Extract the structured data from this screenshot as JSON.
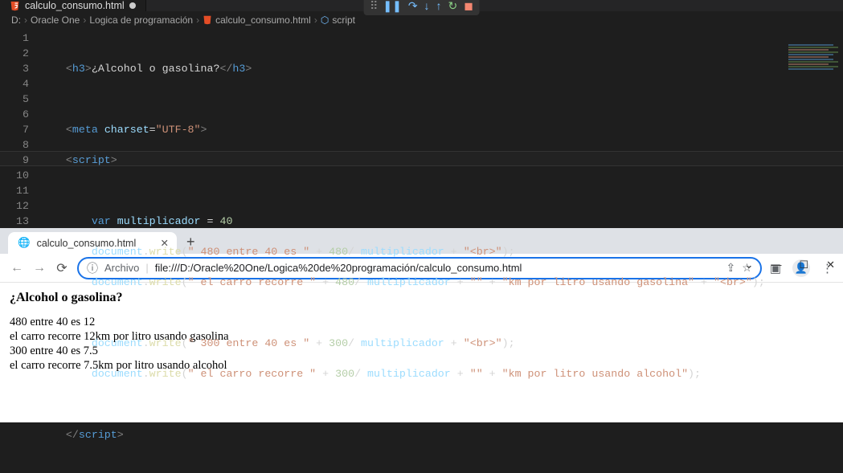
{
  "editor": {
    "tab_filename": "calculo_consumo.html",
    "breadcrumbs": {
      "drive": "D:",
      "p1": "Oracle One",
      "p2": "Logica de programación",
      "file": "calculo_consumo.html",
      "symbol": "script"
    },
    "line_numbers": [
      "1",
      "2",
      "3",
      "4",
      "5",
      "6",
      "7",
      "8",
      "9",
      "10",
      "11",
      "12",
      "13"
    ],
    "code": {
      "l1": {
        "pre": "    ",
        "open": "<",
        "tag": "h3",
        "close": ">",
        "text": "¿Alcohol o gasolina?",
        "open2": "</",
        "tag2": "h3",
        "close2": ">"
      },
      "l3": {
        "pre": "    ",
        "open": "<",
        "tag": "meta",
        "sp": " ",
        "attr": "charset",
        "eq": "=",
        "val": "\"UTF-8\"",
        "close": ">"
      },
      "l4": {
        "pre": "    ",
        "open": "<",
        "tag": "script",
        "close": ">"
      },
      "l6": {
        "pre": "        ",
        "kw": "var",
        "sp": " ",
        "id": "multiplicador",
        "rest": " = ",
        "num": "40"
      },
      "l7": {
        "pre": "        ",
        "obj": "document",
        "dot": ".",
        "fn": "write",
        "open": "(",
        "s1": "\" 480 entre 40 es \"",
        "p1": " + ",
        "n1": "480",
        "p2": "/ ",
        "id": "multiplicador",
        "p3": " + ",
        "s2": "\"<br>\"",
        "close": ");"
      },
      "l8": {
        "pre": "        ",
        "obj": "document",
        "dot": ".",
        "fn": "write",
        "open": "(",
        "s1": "\" el carro recorre \"",
        "p1": " + ",
        "n1": "480",
        "p2": "/ ",
        "id": "multiplicador",
        "p3": " + ",
        "s2": "\"\"",
        "p4": " + ",
        "s3": "\"km por litro usando gasolina\"",
        "p5": " + ",
        "s4": "\"<br>\"",
        "close": ");"
      },
      "l10": {
        "pre": "        ",
        "obj": "document",
        "dot": ".",
        "fn": "write",
        "open": "(",
        "s1": "\" 300 entre 40 es \"",
        "p1": " + ",
        "n1": "300",
        "p2": "/ ",
        "id": "multiplicador",
        "p3": " + ",
        "s2": "\"<br>\"",
        "close": ");"
      },
      "l11": {
        "pre": "        ",
        "obj": "document",
        "dot": ".",
        "fn": "write",
        "open": "(",
        "s1": "\" el carro recorre \"",
        "p1": " + ",
        "n1": "300",
        "p2": "/ ",
        "id": "multiplicador",
        "p3": " + ",
        "s2": "\"\"",
        "p4": " + ",
        "s3": "\"km por litro usando alcohol\"",
        "close": ");"
      },
      "l13": {
        "pre": "    ",
        "open": "</",
        "tag": "script",
        "close": ">"
      }
    }
  },
  "browser": {
    "tab_title": "calculo_consumo.html",
    "url_label": "Archivo",
    "url": "file:///D:/Oracle%20One/Logica%20de%20programación/calculo_consumo.html",
    "page": {
      "heading": "¿Alcohol o gasolina?",
      "line1": "480 entre 40 es 12",
      "line2": "el carro recorre 12km por litro usando gasolina",
      "line3": "300 entre 40 es 7.5",
      "line4": "el carro recorre 7.5km por litro usando alcohol"
    }
  }
}
